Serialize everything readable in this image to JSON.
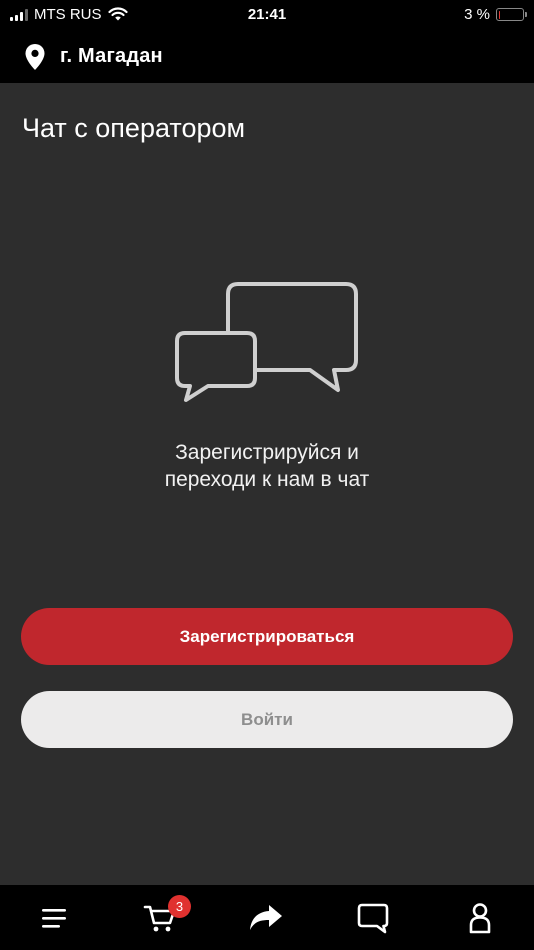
{
  "status_bar": {
    "carrier": "MTS RUS",
    "time": "21:41",
    "battery_percent": "3 %",
    "battery_level": 0.03
  },
  "header": {
    "city": "г. Магадан",
    "location_icon": "location-pin-icon"
  },
  "main": {
    "title": "Чат с оператором",
    "illustration_icon": "chat-bubbles-icon",
    "prompt_line1": "Зарегистрируйся и",
    "prompt_line2": "переходи к нам в чат",
    "register_label": "Зарегистрироваться",
    "login_label": "Войти"
  },
  "tab_bar": {
    "items": [
      {
        "icon": "menu-icon"
      },
      {
        "icon": "cart-icon",
        "badge": "3"
      },
      {
        "icon": "share-icon"
      },
      {
        "icon": "chat-icon"
      },
      {
        "icon": "profile-icon"
      }
    ]
  },
  "colors": {
    "accent": "#c0272d",
    "background": "#2d2d2d",
    "secondary_button": "#ecebeb",
    "badge": "#e0312f"
  }
}
